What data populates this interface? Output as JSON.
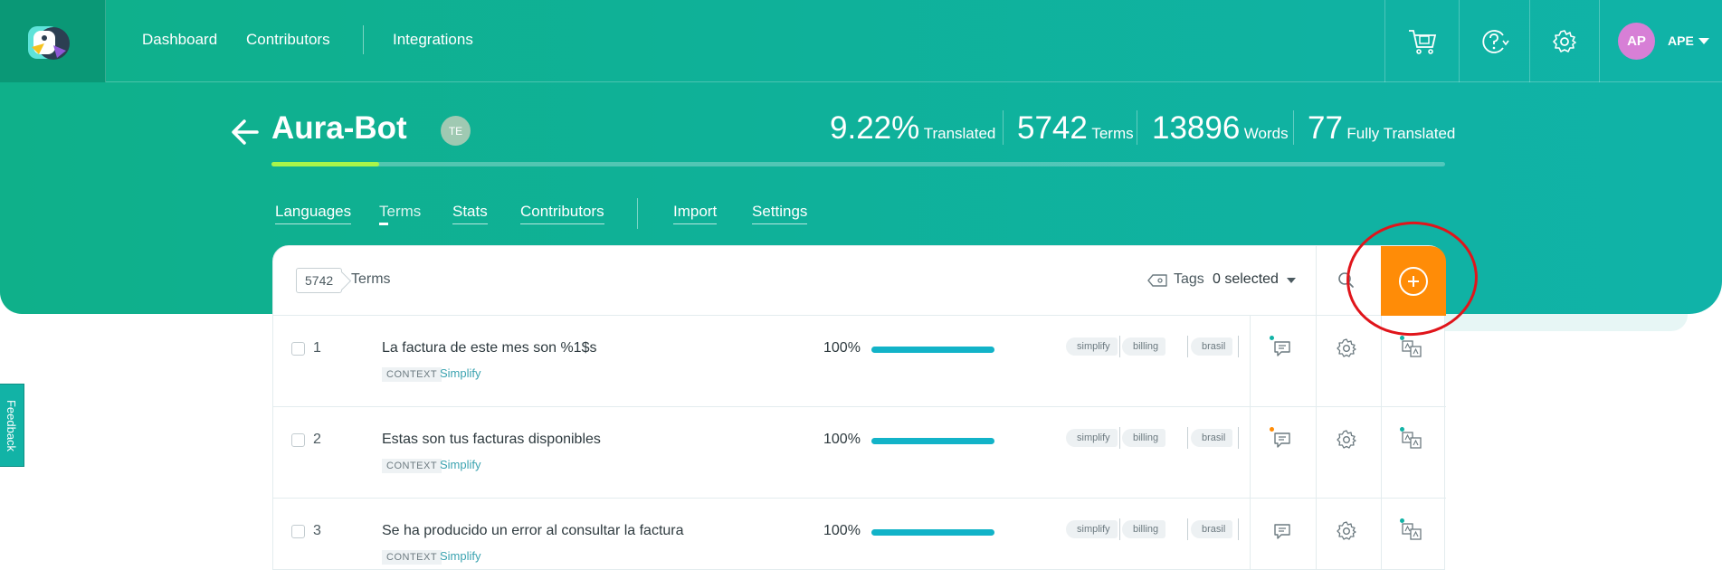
{
  "nav": {
    "links": [
      "Dashboard",
      "Contributors",
      "Integrations"
    ],
    "user": {
      "initials": "AP",
      "name": "APE"
    }
  },
  "project": {
    "title": "Aura-Bot",
    "team_initials": "TE",
    "progress_fraction": 0.092,
    "stats": [
      {
        "value": "9.22%",
        "label": "Translated"
      },
      {
        "value": "5742",
        "label": "Terms"
      },
      {
        "value": "13896",
        "label": "Words"
      },
      {
        "value": "77",
        "label": "Fully Translated"
      }
    ],
    "tabs": [
      "Languages",
      "Terms",
      "Stats",
      "Contributors",
      "Import",
      "Settings"
    ],
    "active_tab": "Terms"
  },
  "toolbar": {
    "count": "5742",
    "count_label": "Terms",
    "tags_label": "Tags",
    "tags_selected": "0 selected"
  },
  "rows": [
    {
      "index": "1",
      "term": "La factura de este mes son %1$s",
      "context_label": "CONTEXT",
      "context": "Simplify",
      "percent": "100%",
      "progress": 1.0,
      "tags": [
        "simplify",
        "billing",
        "brasil"
      ]
    },
    {
      "index": "2",
      "term": "Estas son tus facturas disponibles",
      "context_label": "CONTEXT",
      "context": "Simplify",
      "percent": "100%",
      "progress": 1.0,
      "tags": [
        "simplify",
        "billing",
        "brasil"
      ]
    },
    {
      "index": "3",
      "term": "Se ha producido un error al consultar la factura",
      "context_label": "CONTEXT",
      "context": "Simplify",
      "percent": "100%",
      "progress": 1.0,
      "tags": [
        "simplify",
        "billing",
        "brasil"
      ]
    }
  ],
  "feedback_label": "Feedback",
  "colors": {
    "accent": "#12b3c8",
    "add_button": "#ff8c07",
    "progress_fill": "#a8f54a",
    "header_bg": "#0fb199",
    "annotation": "#e0151b"
  }
}
